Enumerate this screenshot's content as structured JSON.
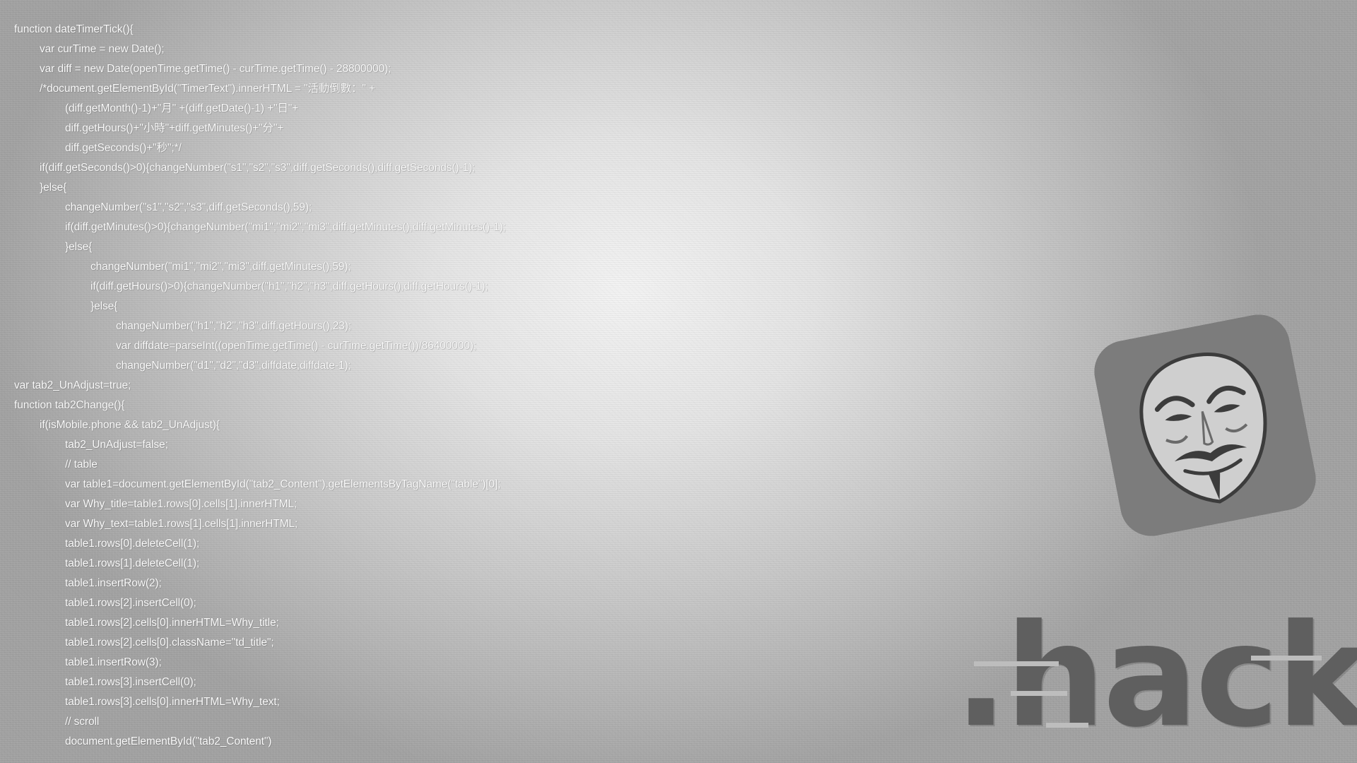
{
  "code": {
    "lines": [
      {
        "indent": 0,
        "text": "function dateTimerTick(){"
      },
      {
        "indent": 1,
        "text": "var curTime = new Date();"
      },
      {
        "indent": 1,
        "text": "var diff = new Date(openTime.getTime() - curTime.getTime() - 28800000);"
      },
      {
        "indent": 1,
        "text": "/*document.getElementById(\"TimerText\").innerHTML = \"活動倒數：\" +"
      },
      {
        "indent": 2,
        "text": "(diff.getMonth()-1)+\"月\" +(diff.getDate()-1) +\"日\"+"
      },
      {
        "indent": 2,
        "text": "diff.getHours()+\"小時\"+diff.getMinutes()+\"分\"+"
      },
      {
        "indent": 2,
        "text": "diff.getSeconds()+\"秒\";*/"
      },
      {
        "indent": 1,
        "text": "if(diff.getSeconds()>0){changeNumber(\"s1\",\"s2\",\"s3\",diff.getSeconds(),diff.getSeconds()-1);"
      },
      {
        "indent": 1,
        "text": "}else{"
      },
      {
        "indent": 2,
        "text": "changeNumber(\"s1\",\"s2\",\"s3\",diff.getSeconds(),59);"
      },
      {
        "indent": 2,
        "text": "if(diff.getMinutes()>0){changeNumber(\"mi1\",\"mi2\",\"mi3\",diff.getMinutes(),diff.getMinutes()-1);"
      },
      {
        "indent": 2,
        "text": "}else{"
      },
      {
        "indent": 3,
        "text": "changeNumber(\"mi1\",\"mi2\",\"mi3\",diff.getMinutes(),59);"
      },
      {
        "indent": 3,
        "text": "if(diff.getHours()>0){changeNumber(\"h1\",\"h2\",\"h3\",diff.getHours(),diff.getHours()-1);"
      },
      {
        "indent": 3,
        "text": "}else{"
      },
      {
        "indent": 4,
        "text": "changeNumber(\"h1\",\"h2\",\"h3\",diff.getHours(),23);"
      },
      {
        "indent": 4,
        "text": "var diffdate=parseInt((openTime.getTime() - curTime.getTime())/86400000);"
      },
      {
        "indent": 4,
        "text": "changeNumber(\"d1\",\"d2\",\"d3\",diffdate,diffdate-1);"
      },
      {
        "indent": 0,
        "text": "var tab2_UnAdjust=true;"
      },
      {
        "indent": 0,
        "text": "function tab2Change(){"
      },
      {
        "indent": 1,
        "text": "if(isMobile.phone && tab2_UnAdjust){"
      },
      {
        "indent": 2,
        "text": "tab2_UnAdjust=false;"
      },
      {
        "indent": 2,
        "text": "// table"
      },
      {
        "indent": 2,
        "text": "var table1=document.getElementById(\"tab2_Content\").getElementsByTagName(\"table\")[0];"
      },
      {
        "indent": 2,
        "text": "var Why_title=table1.rows[0].cells[1].innerHTML;"
      },
      {
        "indent": 2,
        "text": "var Why_text=table1.rows[1].cells[1].innerHTML;"
      },
      {
        "indent": 2,
        "text": "table1.rows[0].deleteCell(1);"
      },
      {
        "indent": 2,
        "text": "table1.rows[1].deleteCell(1);"
      },
      {
        "indent": 2,
        "text": "table1.insertRow(2);"
      },
      {
        "indent": 2,
        "text": "table1.rows[2].insertCell(0);"
      },
      {
        "indent": 2,
        "text": "table1.rows[2].cells[0].innerHTML=Why_title;"
      },
      {
        "indent": 2,
        "text": "table1.rows[2].cells[0].className=\"td_title\";"
      },
      {
        "indent": 2,
        "text": "table1.insertRow(3);"
      },
      {
        "indent": 2,
        "text": "table1.rows[3].insertCell(0);"
      },
      {
        "indent": 2,
        "text": "table1.rows[3].cells[0].innerHTML=Why_text;"
      },
      {
        "indent": 2,
        "text": "// scroll"
      },
      {
        "indent": 2,
        "text": "document.getElementById(\"tab2_Content\")"
      }
    ]
  },
  "logo": {
    "icon": "guy-fawkes-mask-icon",
    "wordmark": ".hack"
  },
  "colors": {
    "code_text": "#fbfbfb",
    "logo_tile": "#7c7c7c",
    "wordmark": "#5f5f5f"
  }
}
